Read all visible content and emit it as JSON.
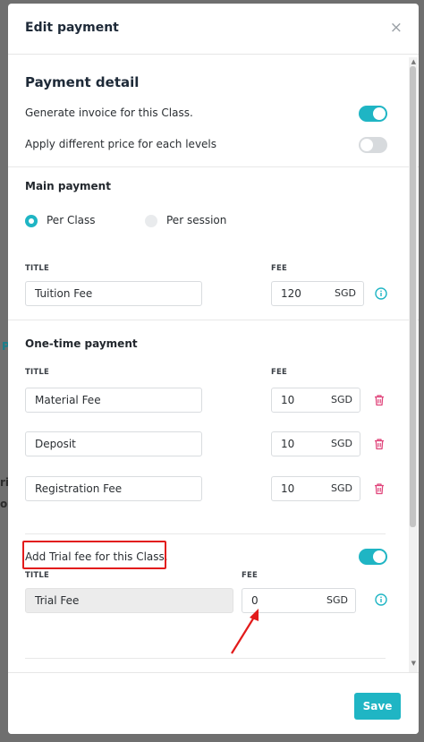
{
  "backdrop": {
    "frag_a": "P",
    "frag_b": "ri",
    "frag_c": "or"
  },
  "modal": {
    "title": "Edit payment",
    "close_glyph": "×"
  },
  "payment_detail": {
    "heading": "Payment detail",
    "generate_invoice_label": "Generate invoice for this Class.",
    "generate_invoice_on": true,
    "different_price_label": "Apply different price for each levels",
    "different_price_on": false
  },
  "main_payment": {
    "heading": "Main payment",
    "options": [
      "Per Class",
      "Per session"
    ],
    "selected": "Per Class",
    "title_header": "TITLE",
    "fee_header": "FEE",
    "title_value": "Tuition Fee",
    "fee_value": "120",
    "currency": "SGD"
  },
  "one_time_payment": {
    "heading": "One-time payment",
    "title_header": "TITLE",
    "fee_header": "FEE",
    "items": [
      {
        "title": "Material Fee",
        "fee": "10",
        "currency": "SGD"
      },
      {
        "title": "Deposit",
        "fee": "10",
        "currency": "SGD"
      },
      {
        "title": "Registration Fee",
        "fee": "10",
        "currency": "SGD"
      }
    ]
  },
  "trial": {
    "label": "Add Trial fee for this Class.",
    "enabled": true,
    "title_header": "TITLE",
    "fee_header": "FEE",
    "title_value": "Trial Fee",
    "fee_value": "0",
    "currency": "SGD"
  },
  "footer": {
    "save_label": "Save"
  },
  "colors": {
    "accent": "#1fb5c4",
    "delete": "#e0457b",
    "highlight": "#e21b1b"
  },
  "icons": [
    "close-icon",
    "info-icon",
    "trash-icon",
    "annotation-arrow-icon"
  ]
}
